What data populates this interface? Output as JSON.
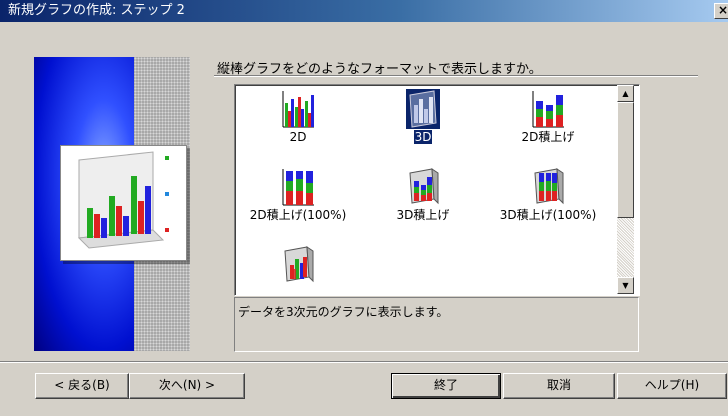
{
  "window": {
    "title": "新規グラフの作成: ステップ 2",
    "close_label": "×"
  },
  "question": "縦棒グラフをどのようなフォーマットで表示しますか。",
  "formats": [
    {
      "label": "2D",
      "selected": false
    },
    {
      "label": "3D",
      "selected": true
    },
    {
      "label": "2D積上げ",
      "selected": false
    },
    {
      "label": "2D積上げ(100%)",
      "selected": false
    },
    {
      "label": "3D積上げ",
      "selected": false
    },
    {
      "label": "3D積上げ(100%)",
      "selected": false
    },
    {
      "label": "",
      "selected": false
    }
  ],
  "description": "データを3次元のグラフに表示します。",
  "buttons": {
    "back": "< 戻る(B)",
    "next": "次へ(N) >",
    "finish": "終了",
    "cancel": "取消",
    "help": "ヘルプ(H)"
  },
  "colors": {
    "title_start": "#0a246a",
    "title_end": "#a6caf0",
    "selection": "#0a246a"
  }
}
